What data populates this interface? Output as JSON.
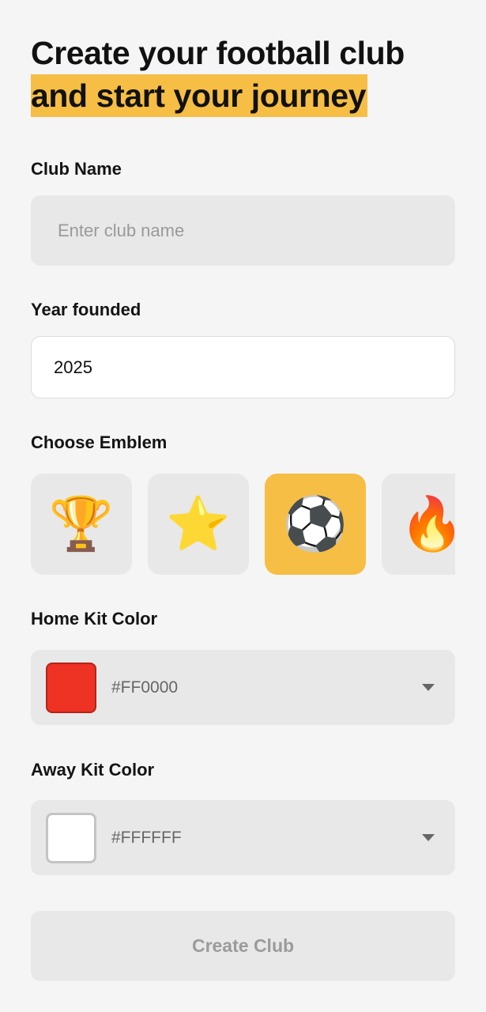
{
  "header": {
    "title_line1": "Create your football club",
    "title_line2": "and start your journey",
    "highlight_color": "#f6be44"
  },
  "club_name": {
    "label": "Club Name",
    "placeholder": "Enter club name",
    "value": ""
  },
  "year_founded": {
    "label": "Year founded",
    "value": "2025"
  },
  "emblem": {
    "label": "Choose Emblem",
    "options": [
      {
        "icon": "trophy-icon",
        "glyph": "🏆",
        "selected": false
      },
      {
        "icon": "star-icon",
        "glyph": "⭐",
        "selected": false
      },
      {
        "icon": "soccer-ball-icon",
        "glyph": "⚽",
        "selected": true
      },
      {
        "icon": "fire-icon",
        "glyph": "🔥",
        "selected": false
      }
    ]
  },
  "home_kit": {
    "label": "Home Kit Color",
    "value": "#FF0000",
    "swatch_color": "#ee3224"
  },
  "away_kit": {
    "label": "Away Kit Color",
    "value": "#FFFFFF",
    "swatch_color": "#ffffff"
  },
  "actions": {
    "create_label": "Create Club"
  }
}
